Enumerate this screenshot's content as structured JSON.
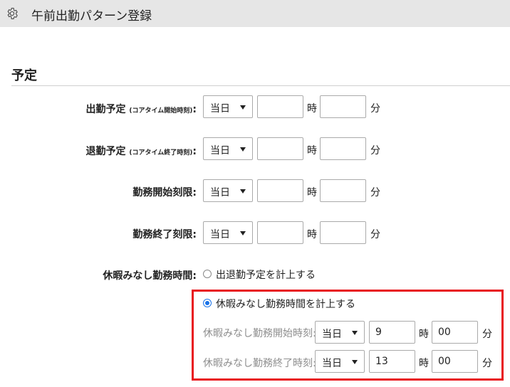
{
  "window": {
    "title": "午前出勤パターン登録",
    "icon": "gear-icon"
  },
  "section": {
    "title": "予定"
  },
  "rows": [
    {
      "label_main": "出勤予定",
      "label_small": "(コアタイム開始時刻)",
      "label_colon": ":",
      "select": "当日",
      "hour": "",
      "minute": "",
      "hour_unit": "時",
      "minute_unit": "分"
    },
    {
      "label_main": "退勤予定",
      "label_small": "(コアタイム終了時刻)",
      "label_colon": ":",
      "select": "当日",
      "hour": "",
      "minute": "",
      "hour_unit": "時",
      "minute_unit": "分"
    },
    {
      "label_main": "勤務開始刻限:",
      "select": "当日",
      "hour": "",
      "minute": "",
      "hour_unit": "時",
      "minute_unit": "分"
    },
    {
      "label_main": "勤務終了刻限:",
      "select": "当日",
      "hour": "",
      "minute": "",
      "hour_unit": "時",
      "minute_unit": "分"
    }
  ],
  "break_free": {
    "label": "休暇みなし勤務時間:",
    "option_actual": "出退勤予定を計上する",
    "option_deemed": "休暇みなし勤務時間を計上する",
    "selected": "休暇みなし勤務時間を計上する",
    "start": {
      "label": "休暇みなし勤務開始時刻:",
      "select": "当日",
      "hour": "9",
      "minute": "00",
      "hour_unit": "時",
      "minute_unit": "分"
    },
    "end": {
      "label": "休暇みなし勤務終了時刻:",
      "select": "当日",
      "hour": "13",
      "minute": "00",
      "hour_unit": "時",
      "minute_unit": "分"
    },
    "highlight_color": "#e8141b",
    "accent_color": "#1a73e8"
  }
}
